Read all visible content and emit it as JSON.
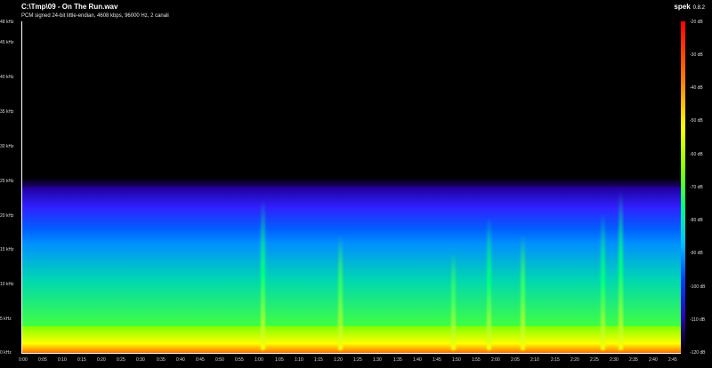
{
  "window": {
    "title": "C:\\Tmp\\09 - On The Run.wav",
    "subtitle": "PCM signed 24-bit little-endian, 4608 kbps, 96000 Hz, 2 canali",
    "app_name": "spek",
    "app_version": "0.8.2"
  },
  "y_axis": {
    "labels": [
      "48 kHz",
      "45 kHz",
      "40 kHz",
      "35 kHz",
      "30 kHz",
      "25 kHz",
      "20 kHz",
      "15 kHz",
      "10 kHz",
      "5 kHz",
      "0 kHz"
    ]
  },
  "x_axis": {
    "labels": [
      "0:00",
      "0:05",
      "0:10",
      "0:15",
      "0:20",
      "0:25",
      "0:30",
      "0:35",
      "0:40",
      "0:45",
      "0:50",
      "0:55",
      "1:00",
      "1:05",
      "1:10",
      "1:15",
      "1:20",
      "1:25",
      "1:30",
      "1:35",
      "1:40",
      "1:45",
      "1:50",
      "1:55",
      "2:00",
      "2:05",
      "2:10",
      "2:15",
      "2:20",
      "2:25",
      "2:30",
      "2:35",
      "2:40",
      "2:45"
    ]
  },
  "color_scale": {
    "labels": [
      "-20 dB",
      "-30 dB",
      "-40 dB",
      "-50 dB",
      "-60 dB",
      "-70 dB",
      "-80 dB",
      "-90 dB",
      "-100 dB",
      "-110 dB",
      "-120 dB"
    ],
    "colors": [
      "#ff0000",
      "#ff8000",
      "#ffff00",
      "#80ff00",
      "#00ff80",
      "#00c0ff",
      "#0040ff",
      "#3000c0",
      "#000000"
    ]
  }
}
